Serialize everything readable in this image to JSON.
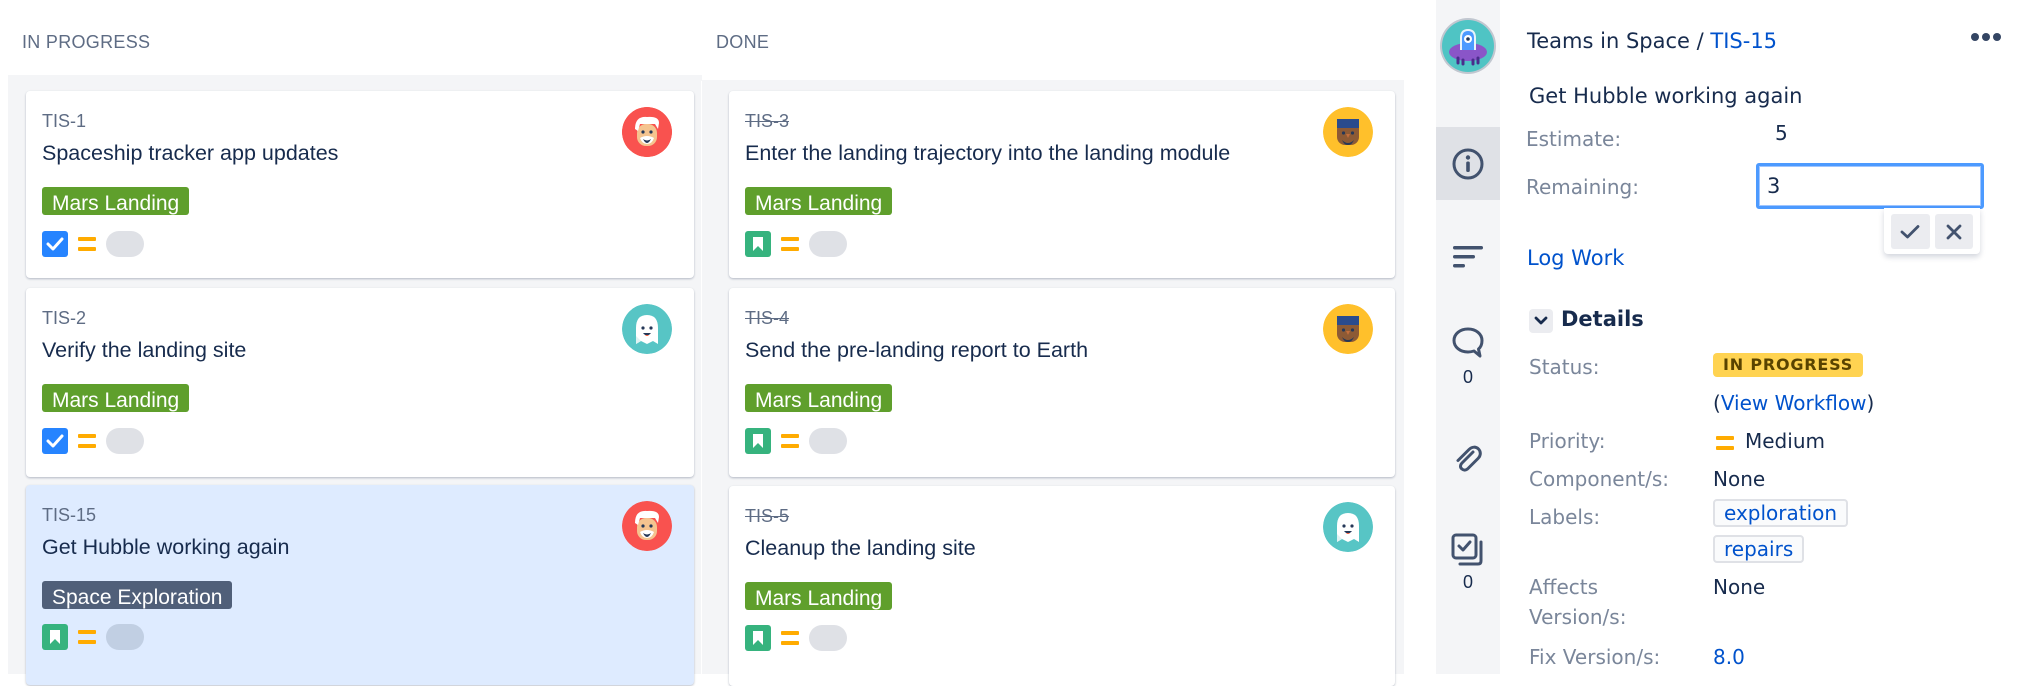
{
  "board": {
    "columns": [
      {
        "title": "IN PROGRESS",
        "cards": [
          {
            "key": "TIS-1",
            "summary": "Spaceship tracker app updates",
            "epic": "Mars Landing",
            "type": "task",
            "priority": "medium",
            "assignee_avatar": "old-man-red",
            "done": false,
            "selected": false
          },
          {
            "key": "TIS-2",
            "summary": "Verify the landing site",
            "epic": "Mars Landing",
            "type": "task",
            "priority": "medium",
            "assignee_avatar": "ghost-teal",
            "done": false,
            "selected": false
          },
          {
            "key": "TIS-15",
            "summary": "Get Hubble working again",
            "epic": "Space Exploration",
            "type": "story",
            "priority": "medium",
            "assignee_avatar": "old-man-red",
            "done": false,
            "selected": true
          }
        ]
      },
      {
        "title": "DONE",
        "cards": [
          {
            "key": "TIS-3",
            "summary": "Enter the landing trajectory into the landing module",
            "epic": "Mars Landing",
            "type": "story",
            "priority": "medium",
            "assignee_avatar": "man-yellow",
            "done": true,
            "selected": false
          },
          {
            "key": "TIS-4",
            "summary": "Send the pre-landing report to Earth",
            "epic": "Mars Landing",
            "type": "story",
            "priority": "medium",
            "assignee_avatar": "man-yellow",
            "done": true,
            "selected": false
          },
          {
            "key": "TIS-5",
            "summary": "Cleanup the landing site",
            "epic": "Mars Landing",
            "type": "story",
            "priority": "medium",
            "assignee_avatar": "ghost-teal",
            "done": true,
            "selected": false
          }
        ]
      }
    ],
    "colors": {
      "epic_mars": "#5f9f2c",
      "epic_space": "#505f79",
      "selected_card": "#deebff"
    }
  },
  "panel": {
    "project": "Teams in Space",
    "separator": "/",
    "issue_key": "TIS-15",
    "summary": "Get Hubble working again",
    "more_icon": "ellipsis-icon",
    "sidebar": {
      "items": [
        {
          "icon": "info-icon",
          "active": true,
          "count": null
        },
        {
          "icon": "description-icon",
          "active": false,
          "count": null
        },
        {
          "icon": "comment-icon",
          "active": false,
          "count": "0"
        },
        {
          "icon": "attachment-icon",
          "active": false,
          "count": null
        },
        {
          "icon": "subtasks-icon",
          "active": false,
          "count": "0"
        }
      ]
    },
    "estimate": {
      "label": "Estimate:",
      "value": "5"
    },
    "remaining": {
      "label": "Remaining:",
      "value": "3"
    },
    "log_work": "Log Work",
    "details": {
      "heading": "Details",
      "status_label": "Status:",
      "status_value": "IN PROGRESS",
      "view_workflow_open": "(",
      "view_workflow": "View Workflow",
      "view_workflow_close": ")",
      "priority_label": "Priority:",
      "priority_value": "Medium",
      "components_label": "Component/s:",
      "components_value": "None",
      "labels_label": "Labels:",
      "labels": [
        "exploration",
        "repairs"
      ],
      "affects_label_1": "Affects",
      "affects_label_2": "Version/s:",
      "affects_value": "None",
      "fix_label": "Fix Version/s:",
      "fix_value": "8.0"
    },
    "colors": {
      "status_bg": "#ffd351",
      "status_text": "#594300",
      "link": "#0052cc",
      "input_focus": "#4c9aff"
    }
  }
}
